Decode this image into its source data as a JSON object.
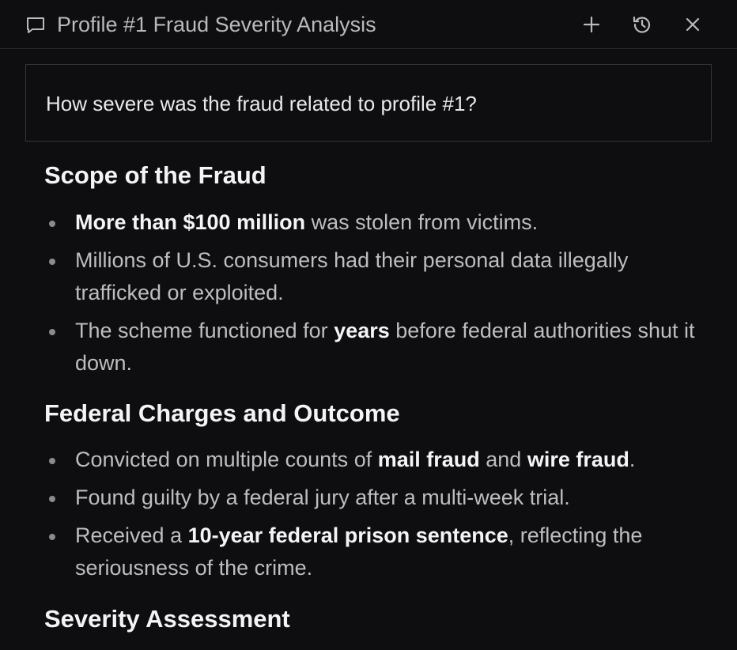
{
  "header": {
    "title": "Profile #1 Fraud Severity Analysis",
    "icons": [
      "chat-bubble-icon",
      "plus-icon",
      "history-icon",
      "close-icon"
    ]
  },
  "question": {
    "text": "How severe was the fraud related to profile #1?"
  },
  "sections": [
    {
      "heading": "Scope of the Fraud",
      "bullets": [
        {
          "parts": [
            {
              "t": "More than $100 million",
              "b": true
            },
            {
              "t": " was stolen from victims."
            }
          ]
        },
        {
          "parts": [
            {
              "t": "Millions of U.S. consumers had their personal data illegally trafficked or exploited."
            }
          ]
        },
        {
          "parts": [
            {
              "t": "The scheme functioned for "
            },
            {
              "t": "years",
              "b": true
            },
            {
              "t": " before federal authorities shut it down."
            }
          ]
        }
      ]
    },
    {
      "heading": "Federal Charges and Outcome",
      "bullets": [
        {
          "parts": [
            {
              "t": "Convicted on multiple counts of "
            },
            {
              "t": "mail fraud",
              "b": true
            },
            {
              "t": " and "
            },
            {
              "t": "wire fraud",
              "b": true
            },
            {
              "t": "."
            }
          ]
        },
        {
          "parts": [
            {
              "t": "Found guilty by a federal jury after a multi-week trial."
            }
          ]
        },
        {
          "parts": [
            {
              "t": "Received a "
            },
            {
              "t": "10-year federal prison sentence",
              "b": true
            },
            {
              "t": ", reflecting the seriousness of the crime."
            }
          ]
        }
      ]
    },
    {
      "heading": "Severity Assessment",
      "bullets": []
    }
  ]
}
